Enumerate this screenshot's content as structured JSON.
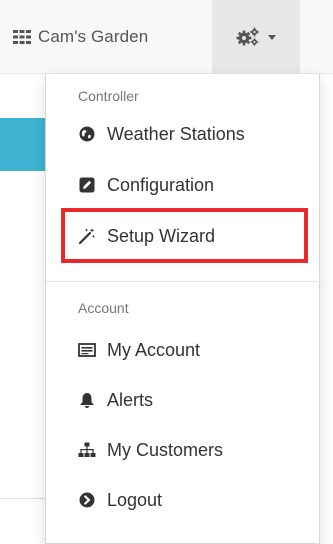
{
  "navbar": {
    "brand_label": "Cam's Garden",
    "brand_icon": "grid-icon",
    "settings_icon": "gears-icon",
    "caret_icon": "caret-down-icon"
  },
  "menu": {
    "controller_header": "Controller",
    "account_header": "Account",
    "items": [
      {
        "label": "Weather Stations",
        "icon": "globe-icon"
      },
      {
        "label": "Configuration",
        "icon": "edit-icon"
      },
      {
        "label": "Setup Wizard",
        "icon": "magic-wand-icon"
      },
      {
        "label": "My Account",
        "icon": "card-icon"
      },
      {
        "label": "Alerts",
        "icon": "bell-icon"
      },
      {
        "label": "My Customers",
        "icon": "sitemap-icon"
      },
      {
        "label": "Logout",
        "icon": "circle-arrow-icon"
      }
    ]
  },
  "colors": {
    "highlight": "#e8282b",
    "accent": "#3fb3d2"
  }
}
